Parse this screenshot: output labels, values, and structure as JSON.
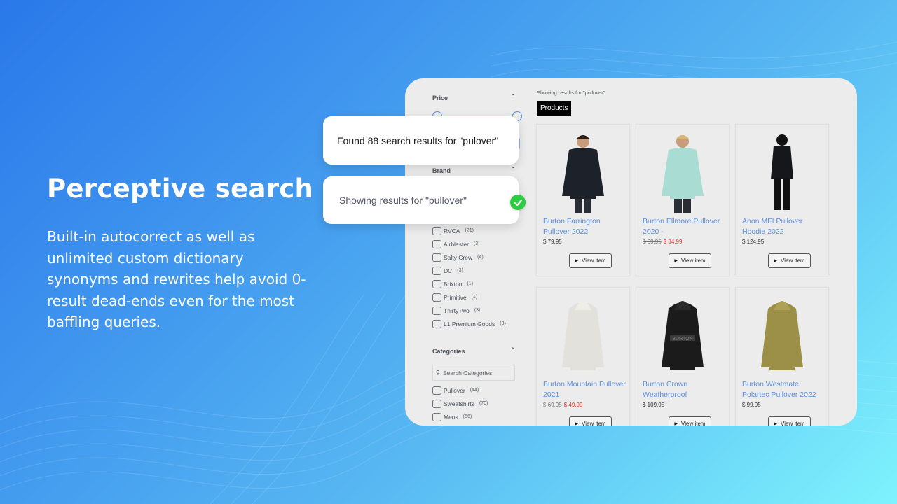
{
  "hero": {
    "title": "Perceptive search",
    "body": "Built-in autocorrect as well as unlimited custom dictionary synonyms and rewrites help avoid 0-result dead-ends even for the most baffling queries."
  },
  "callouts": {
    "found": "Found 88 search results for \"pulover\"",
    "showing": "Showing results for \"pullover\"",
    "check_icon": "checkmark-circle-icon"
  },
  "sidebar": {
    "price_title": "Price",
    "brand_title": "Brand",
    "categories_title": "Categories",
    "brands": [
      {
        "label": "RVCA",
        "count": "(21)"
      },
      {
        "label": "Airblaster",
        "count": "(3)"
      },
      {
        "label": "Salty Crew",
        "count": "(4)"
      },
      {
        "label": "DC",
        "count": "(3)"
      },
      {
        "label": "Brixton",
        "count": "(1)"
      },
      {
        "label": "Primitive",
        "count": "(1)"
      },
      {
        "label": "ThirtyTwo",
        "count": "(3)"
      },
      {
        "label": "L1 Premium Goods",
        "count": "(3)"
      }
    ],
    "category_search_placeholder": "Search Categories",
    "categories": [
      {
        "label": "Pullover",
        "count": "(44)"
      },
      {
        "label": "Sweatshirts",
        "count": "(70)"
      },
      {
        "label": "Mens",
        "count": "(56)"
      }
    ]
  },
  "results": {
    "showing_text": "Showing results for \"pullover\"",
    "tab_label": "Products",
    "view_label": "View item",
    "products": [
      {
        "name": "Burton Farrington Pullover 2022",
        "price": "$ 79.95",
        "old_price": "",
        "sale_price": "",
        "garment": "black-hoodie-model"
      },
      {
        "name": "Burton Ellmore Pullover 2020 -",
        "price": "",
        "old_price": "$ 69.95",
        "sale_price": "$ 34.99",
        "garment": "mint-pullover-model"
      },
      {
        "name": "Anon MFI Pullover Hoodie 2022",
        "price": "$ 124.95",
        "old_price": "",
        "sale_price": "",
        "garment": "black-outfit-model"
      },
      {
        "name": "Burton Mountain Pullover 2021",
        "price": "",
        "old_price": "$ 69.95",
        "sale_price": "$ 49.99",
        "garment": "white-hoodie"
      },
      {
        "name": "Burton Crown Weatherproof",
        "price": "$ 109.95",
        "old_price": "",
        "sale_price": "",
        "garment": "black-anorak",
        "print": "BURTON"
      },
      {
        "name": "Burton Westmate Polartec Pullover 2022",
        "price": "$ 99.95",
        "old_price": "",
        "sale_price": "",
        "garment": "olive-hoodie"
      }
    ]
  },
  "colors": {
    "link": "#5a8ee0",
    "sale": "#e0352b",
    "success": "#2ecc40",
    "panel_bg": "#ececec"
  }
}
